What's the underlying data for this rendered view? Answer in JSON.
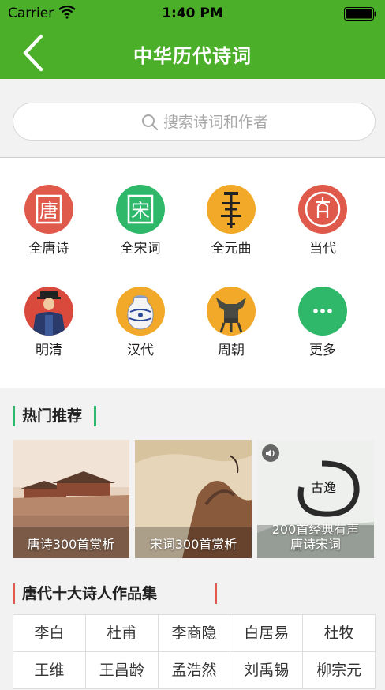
{
  "status": {
    "carrier": "Carrier",
    "time": "1:40 PM"
  },
  "nav": {
    "title": "中华历代诗词"
  },
  "search": {
    "placeholder": "搜索诗词和作者"
  },
  "categories": [
    {
      "label": "全唐诗",
      "color": "#e05a4b",
      "glyph": "唐"
    },
    {
      "label": "全宋词",
      "color": "#2fb86a",
      "glyph": "宋"
    },
    {
      "label": "全元曲",
      "color": "#f2a828",
      "glyph": ""
    },
    {
      "label": "当代",
      "color": "#e05a4b",
      "glyph": ""
    },
    {
      "label": "明清",
      "color": "#d94a3d"
    },
    {
      "label": "汉代",
      "color": "#f2a828"
    },
    {
      "label": "周朝",
      "color": "#f2a828"
    },
    {
      "label": "更多",
      "color": "#2fb86a"
    }
  ],
  "hot": {
    "title": "热门推荐",
    "items": [
      {
        "caption": "唐诗300首赏析"
      },
      {
        "caption": "宋词300首赏析"
      },
      {
        "caption_line1": "200首经典有声",
        "caption_line2": "唐诗宋词",
        "seal_text": "古逸"
      }
    ]
  },
  "poets": {
    "title": "唐代十大诗人作品集",
    "rows": [
      [
        "李白",
        "杜甫",
        "李商隐",
        "白居易",
        "杜牧"
      ],
      [
        "王维",
        "王昌龄",
        "孟浩然",
        "刘禹锡",
        "柳宗元"
      ]
    ]
  },
  "colors": {
    "green": "#4caf2a",
    "accent_red": "#e05a4b",
    "accent_green": "#2fb86a"
  }
}
